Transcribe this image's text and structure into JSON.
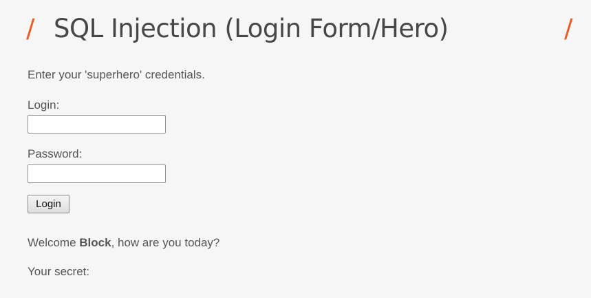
{
  "header": {
    "slash_left": "/",
    "title": "SQL Injection (Login Form/Hero)",
    "slash_right": "/",
    "accent_color": "#ee5a24"
  },
  "form": {
    "intro": "Enter your 'superhero' credentials.",
    "login_label": "Login:",
    "login_value": "",
    "password_label": "Password:",
    "password_value": "",
    "submit_label": "Login"
  },
  "result": {
    "welcome_prefix": "Welcome ",
    "user_name": "Block",
    "welcome_suffix": ", how are you today?",
    "secret_label": "Your secret:"
  }
}
